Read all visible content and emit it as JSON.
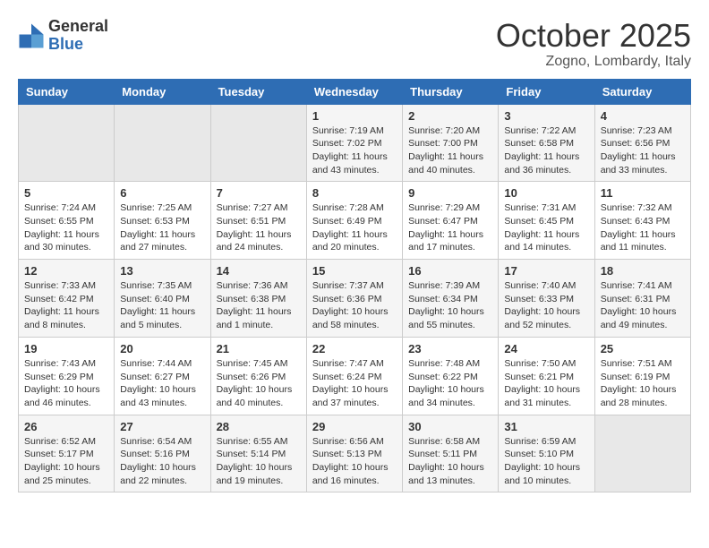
{
  "header": {
    "logo_general": "General",
    "logo_blue": "Blue",
    "month_title": "October 2025",
    "subtitle": "Zogno, Lombardy, Italy"
  },
  "weekdays": [
    "Sunday",
    "Monday",
    "Tuesday",
    "Wednesday",
    "Thursday",
    "Friday",
    "Saturday"
  ],
  "weeks": [
    [
      {
        "day": "",
        "info": ""
      },
      {
        "day": "",
        "info": ""
      },
      {
        "day": "",
        "info": ""
      },
      {
        "day": "1",
        "info": "Sunrise: 7:19 AM\nSunset: 7:02 PM\nDaylight: 11 hours and 43 minutes."
      },
      {
        "day": "2",
        "info": "Sunrise: 7:20 AM\nSunset: 7:00 PM\nDaylight: 11 hours and 40 minutes."
      },
      {
        "day": "3",
        "info": "Sunrise: 7:22 AM\nSunset: 6:58 PM\nDaylight: 11 hours and 36 minutes."
      },
      {
        "day": "4",
        "info": "Sunrise: 7:23 AM\nSunset: 6:56 PM\nDaylight: 11 hours and 33 minutes."
      }
    ],
    [
      {
        "day": "5",
        "info": "Sunrise: 7:24 AM\nSunset: 6:55 PM\nDaylight: 11 hours and 30 minutes."
      },
      {
        "day": "6",
        "info": "Sunrise: 7:25 AM\nSunset: 6:53 PM\nDaylight: 11 hours and 27 minutes."
      },
      {
        "day": "7",
        "info": "Sunrise: 7:27 AM\nSunset: 6:51 PM\nDaylight: 11 hours and 24 minutes."
      },
      {
        "day": "8",
        "info": "Sunrise: 7:28 AM\nSunset: 6:49 PM\nDaylight: 11 hours and 20 minutes."
      },
      {
        "day": "9",
        "info": "Sunrise: 7:29 AM\nSunset: 6:47 PM\nDaylight: 11 hours and 17 minutes."
      },
      {
        "day": "10",
        "info": "Sunrise: 7:31 AM\nSunset: 6:45 PM\nDaylight: 11 hours and 14 minutes."
      },
      {
        "day": "11",
        "info": "Sunrise: 7:32 AM\nSunset: 6:43 PM\nDaylight: 11 hours and 11 minutes."
      }
    ],
    [
      {
        "day": "12",
        "info": "Sunrise: 7:33 AM\nSunset: 6:42 PM\nDaylight: 11 hours and 8 minutes."
      },
      {
        "day": "13",
        "info": "Sunrise: 7:35 AM\nSunset: 6:40 PM\nDaylight: 11 hours and 5 minutes."
      },
      {
        "day": "14",
        "info": "Sunrise: 7:36 AM\nSunset: 6:38 PM\nDaylight: 11 hours and 1 minute."
      },
      {
        "day": "15",
        "info": "Sunrise: 7:37 AM\nSunset: 6:36 PM\nDaylight: 10 hours and 58 minutes."
      },
      {
        "day": "16",
        "info": "Sunrise: 7:39 AM\nSunset: 6:34 PM\nDaylight: 10 hours and 55 minutes."
      },
      {
        "day": "17",
        "info": "Sunrise: 7:40 AM\nSunset: 6:33 PM\nDaylight: 10 hours and 52 minutes."
      },
      {
        "day": "18",
        "info": "Sunrise: 7:41 AM\nSunset: 6:31 PM\nDaylight: 10 hours and 49 minutes."
      }
    ],
    [
      {
        "day": "19",
        "info": "Sunrise: 7:43 AM\nSunset: 6:29 PM\nDaylight: 10 hours and 46 minutes."
      },
      {
        "day": "20",
        "info": "Sunrise: 7:44 AM\nSunset: 6:27 PM\nDaylight: 10 hours and 43 minutes."
      },
      {
        "day": "21",
        "info": "Sunrise: 7:45 AM\nSunset: 6:26 PM\nDaylight: 10 hours and 40 minutes."
      },
      {
        "day": "22",
        "info": "Sunrise: 7:47 AM\nSunset: 6:24 PM\nDaylight: 10 hours and 37 minutes."
      },
      {
        "day": "23",
        "info": "Sunrise: 7:48 AM\nSunset: 6:22 PM\nDaylight: 10 hours and 34 minutes."
      },
      {
        "day": "24",
        "info": "Sunrise: 7:50 AM\nSunset: 6:21 PM\nDaylight: 10 hours and 31 minutes."
      },
      {
        "day": "25",
        "info": "Sunrise: 7:51 AM\nSunset: 6:19 PM\nDaylight: 10 hours and 28 minutes."
      }
    ],
    [
      {
        "day": "26",
        "info": "Sunrise: 6:52 AM\nSunset: 5:17 PM\nDaylight: 10 hours and 25 minutes."
      },
      {
        "day": "27",
        "info": "Sunrise: 6:54 AM\nSunset: 5:16 PM\nDaylight: 10 hours and 22 minutes."
      },
      {
        "day": "28",
        "info": "Sunrise: 6:55 AM\nSunset: 5:14 PM\nDaylight: 10 hours and 19 minutes."
      },
      {
        "day": "29",
        "info": "Sunrise: 6:56 AM\nSunset: 5:13 PM\nDaylight: 10 hours and 16 minutes."
      },
      {
        "day": "30",
        "info": "Sunrise: 6:58 AM\nSunset: 5:11 PM\nDaylight: 10 hours and 13 minutes."
      },
      {
        "day": "31",
        "info": "Sunrise: 6:59 AM\nSunset: 5:10 PM\nDaylight: 10 hours and 10 minutes."
      },
      {
        "day": "",
        "info": ""
      }
    ]
  ]
}
